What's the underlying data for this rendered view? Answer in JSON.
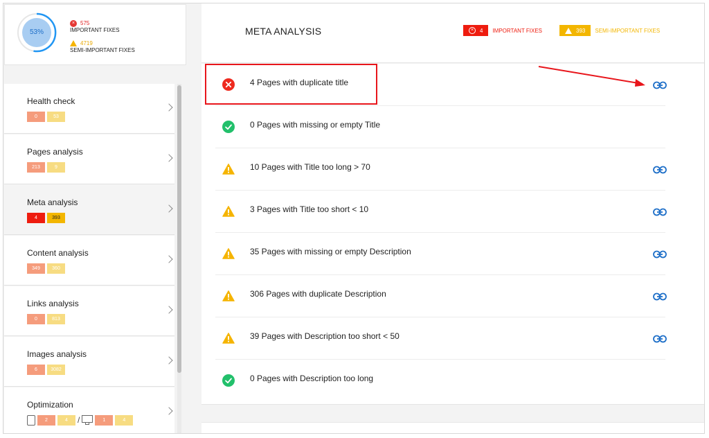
{
  "summary": {
    "percent": "53%",
    "important_count": "575",
    "important_label": "IMPORTANT FIXES",
    "semi_count": "4719",
    "semi_label": "SEMI-IMPORTANT FIXES"
  },
  "nav": [
    {
      "label": "Health check",
      "badges": [
        "0",
        "53"
      ]
    },
    {
      "label": "Pages analysis",
      "badges": [
        "213",
        "9"
      ]
    },
    {
      "label": "Meta analysis",
      "badges": [
        "4",
        "393"
      ]
    },
    {
      "label": "Content analysis",
      "badges": [
        "349",
        "360"
      ]
    },
    {
      "label": "Links analysis",
      "badges": [
        "0",
        "813"
      ]
    },
    {
      "label": "Images analysis",
      "badges": [
        "6",
        "3082"
      ]
    },
    {
      "label": "Optimization",
      "mobile_badges": [
        "2",
        "4"
      ],
      "separator": "/",
      "desktop_badges": [
        "1",
        "4"
      ]
    }
  ],
  "header": {
    "title": "META ANALYSIS",
    "important_count": "4",
    "important_label": "IMPORTANT FIXES",
    "semi_count": "393",
    "semi_label": "SEMI-IMPORTANT FIXES"
  },
  "rows": [
    {
      "text": "4 Pages with duplicate title",
      "status": "error",
      "has_link": true
    },
    {
      "text": "0 Pages with missing or empty Title",
      "status": "ok",
      "has_link": false
    },
    {
      "text": "10 Pages with Title too long > 70",
      "status": "warning",
      "has_link": true
    },
    {
      "text": "3 Pages with Title too short < 10",
      "status": "warning",
      "has_link": true
    },
    {
      "text": "35 Pages with missing or empty Description",
      "status": "warning",
      "has_link": true
    },
    {
      "text": "306 Pages with duplicate Description",
      "status": "warning",
      "has_link": true
    },
    {
      "text": "39 Pages with Description too short < 50",
      "status": "warning",
      "has_link": true
    },
    {
      "text": "0 Pages with Description too long",
      "status": "ok",
      "has_link": false
    }
  ],
  "colors": {
    "error": "#ee2a1f",
    "ok": "#22c06b",
    "warning": "#f5b400",
    "link": "#1e6fc8",
    "highlight": "#e8151b",
    "gauge": "#2196f3"
  },
  "icons": {
    "error": "error-circle-icon",
    "ok": "check-circle-icon",
    "warning": "warning-triangle-icon",
    "link": "link-icon"
  }
}
